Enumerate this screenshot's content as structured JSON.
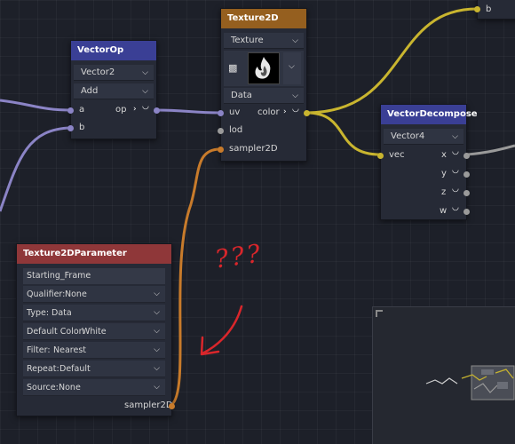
{
  "colors": {
    "vector_wire": "#8b84c6",
    "color_wire": "#c9b52f",
    "sampler_wire": "#c87b2b",
    "gray_wire": "#9a9a9a",
    "annotation": "#d9262b"
  },
  "top_right_node": {
    "port_label": "b"
  },
  "vector_op": {
    "title": "VectorOp",
    "type_value": "Vector2",
    "op_value": "Add",
    "inputs": [
      "a",
      "b"
    ],
    "output": "op"
  },
  "texture2d": {
    "title": "Texture2D",
    "source_value": "Texture",
    "data_value": "Data",
    "inputs": [
      "uv",
      "lod",
      "sampler2D"
    ],
    "output": "color"
  },
  "vector_decompose": {
    "title": "VectorDecompose",
    "type_value": "Vector4",
    "input": "vec",
    "outputs": [
      "x",
      "y",
      "z",
      "w"
    ]
  },
  "texture_param": {
    "title": "Texture2DParameter",
    "name_value": "Starting_Frame",
    "rows": [
      {
        "label": "Qualifier:",
        "value": "None"
      },
      {
        "label": "Type:",
        "value": "Data"
      },
      {
        "label": "Default Color:",
        "value": "White"
      },
      {
        "label": "Filter:",
        "value": "Nearest"
      },
      {
        "label": "Repeat:",
        "value": "Default"
      },
      {
        "label": "Source:",
        "value": "None"
      }
    ],
    "output": "sampler2D"
  },
  "annotation": {
    "text": "???"
  },
  "icons": {
    "dropdown": "chevron-down-icon",
    "expand": "chevron-right-icon",
    "port_cap": "port-cap-icon",
    "film": "film-icon"
  }
}
